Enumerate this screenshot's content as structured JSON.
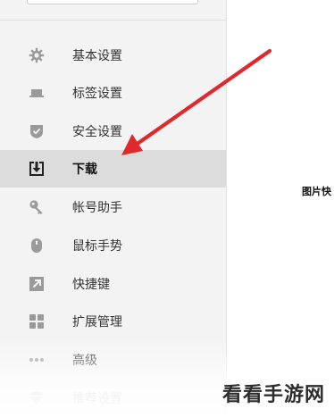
{
  "sidebar": {
    "items": [
      {
        "label": "基本设置",
        "icon": "gear-icon"
      },
      {
        "label": "标签设置",
        "icon": "tab-icon"
      },
      {
        "label": "安全设置",
        "icon": "shield-icon"
      },
      {
        "label": "下载",
        "icon": "download-icon",
        "active": true
      },
      {
        "label": "帐号助手",
        "icon": "key-icon"
      },
      {
        "label": "鼠标手势",
        "icon": "mouse-icon"
      },
      {
        "label": "快捷键",
        "icon": "shortcut-arrow-icon"
      },
      {
        "label": "扩展管理",
        "icon": "extensions-grid-icon"
      },
      {
        "label": "高级",
        "icon": "more-dots-icon"
      },
      {
        "label": "推荐设置",
        "icon": "diamond-icon"
      }
    ]
  },
  "main": {
    "partial_text": "图片快"
  },
  "watermark": {
    "text": "看看手游网"
  },
  "colors": {
    "sidebar_bg": "#f3f3f3",
    "active_bg": "#dcdcdc",
    "icon_gray": "#9a9a9a",
    "arrow_red": "#e0292c"
  }
}
